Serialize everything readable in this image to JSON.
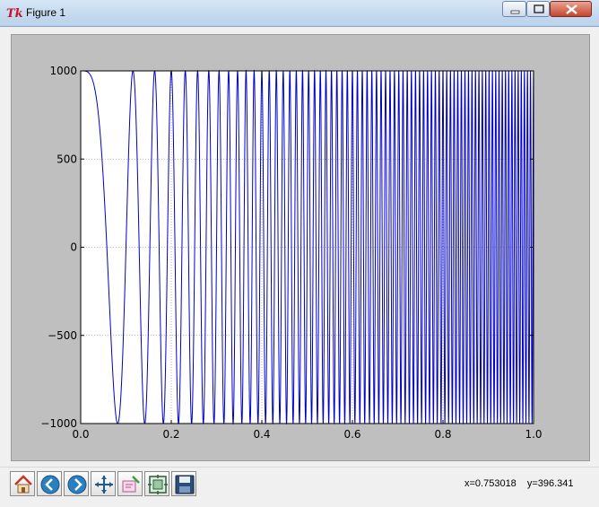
{
  "window": {
    "title": "Figure 1"
  },
  "toolbar": {
    "buttons": [
      {
        "name": "home",
        "icon": "home-icon"
      },
      {
        "name": "back",
        "icon": "back-arrow-icon"
      },
      {
        "name": "forward",
        "icon": "forward-arrow-icon"
      },
      {
        "name": "pan",
        "icon": "pan-arrows-icon"
      },
      {
        "name": "zoom",
        "icon": "zoom-rect-icon"
      },
      {
        "name": "subplots",
        "icon": "subplots-config-icon"
      },
      {
        "name": "save",
        "icon": "save-disk-icon"
      }
    ],
    "coords": {
      "x": "x=0.753018",
      "y": "y=396.341"
    }
  },
  "colors": {
    "line": "#0000cc",
    "canvas_bg": "#bfbfbf",
    "axes_bg": "#ffffff",
    "grid": "#888888"
  },
  "chart_data": {
    "type": "line",
    "title": "",
    "xlabel": "",
    "ylabel": "",
    "xlim": [
      0.0,
      1.0
    ],
    "ylim": [
      -1000,
      1000
    ],
    "xticks": [
      "0.0",
      "0.2",
      "0.4",
      "0.6",
      "0.8",
      "1.0"
    ],
    "yticks": [
      "1000",
      "500",
      "0",
      "−500",
      "−1000"
    ],
    "grid": true,
    "series": [
      {
        "function": "1000*cos(2*pi*75*x^2)",
        "x_start": 0.0,
        "x_end": 1.0
      }
    ]
  }
}
